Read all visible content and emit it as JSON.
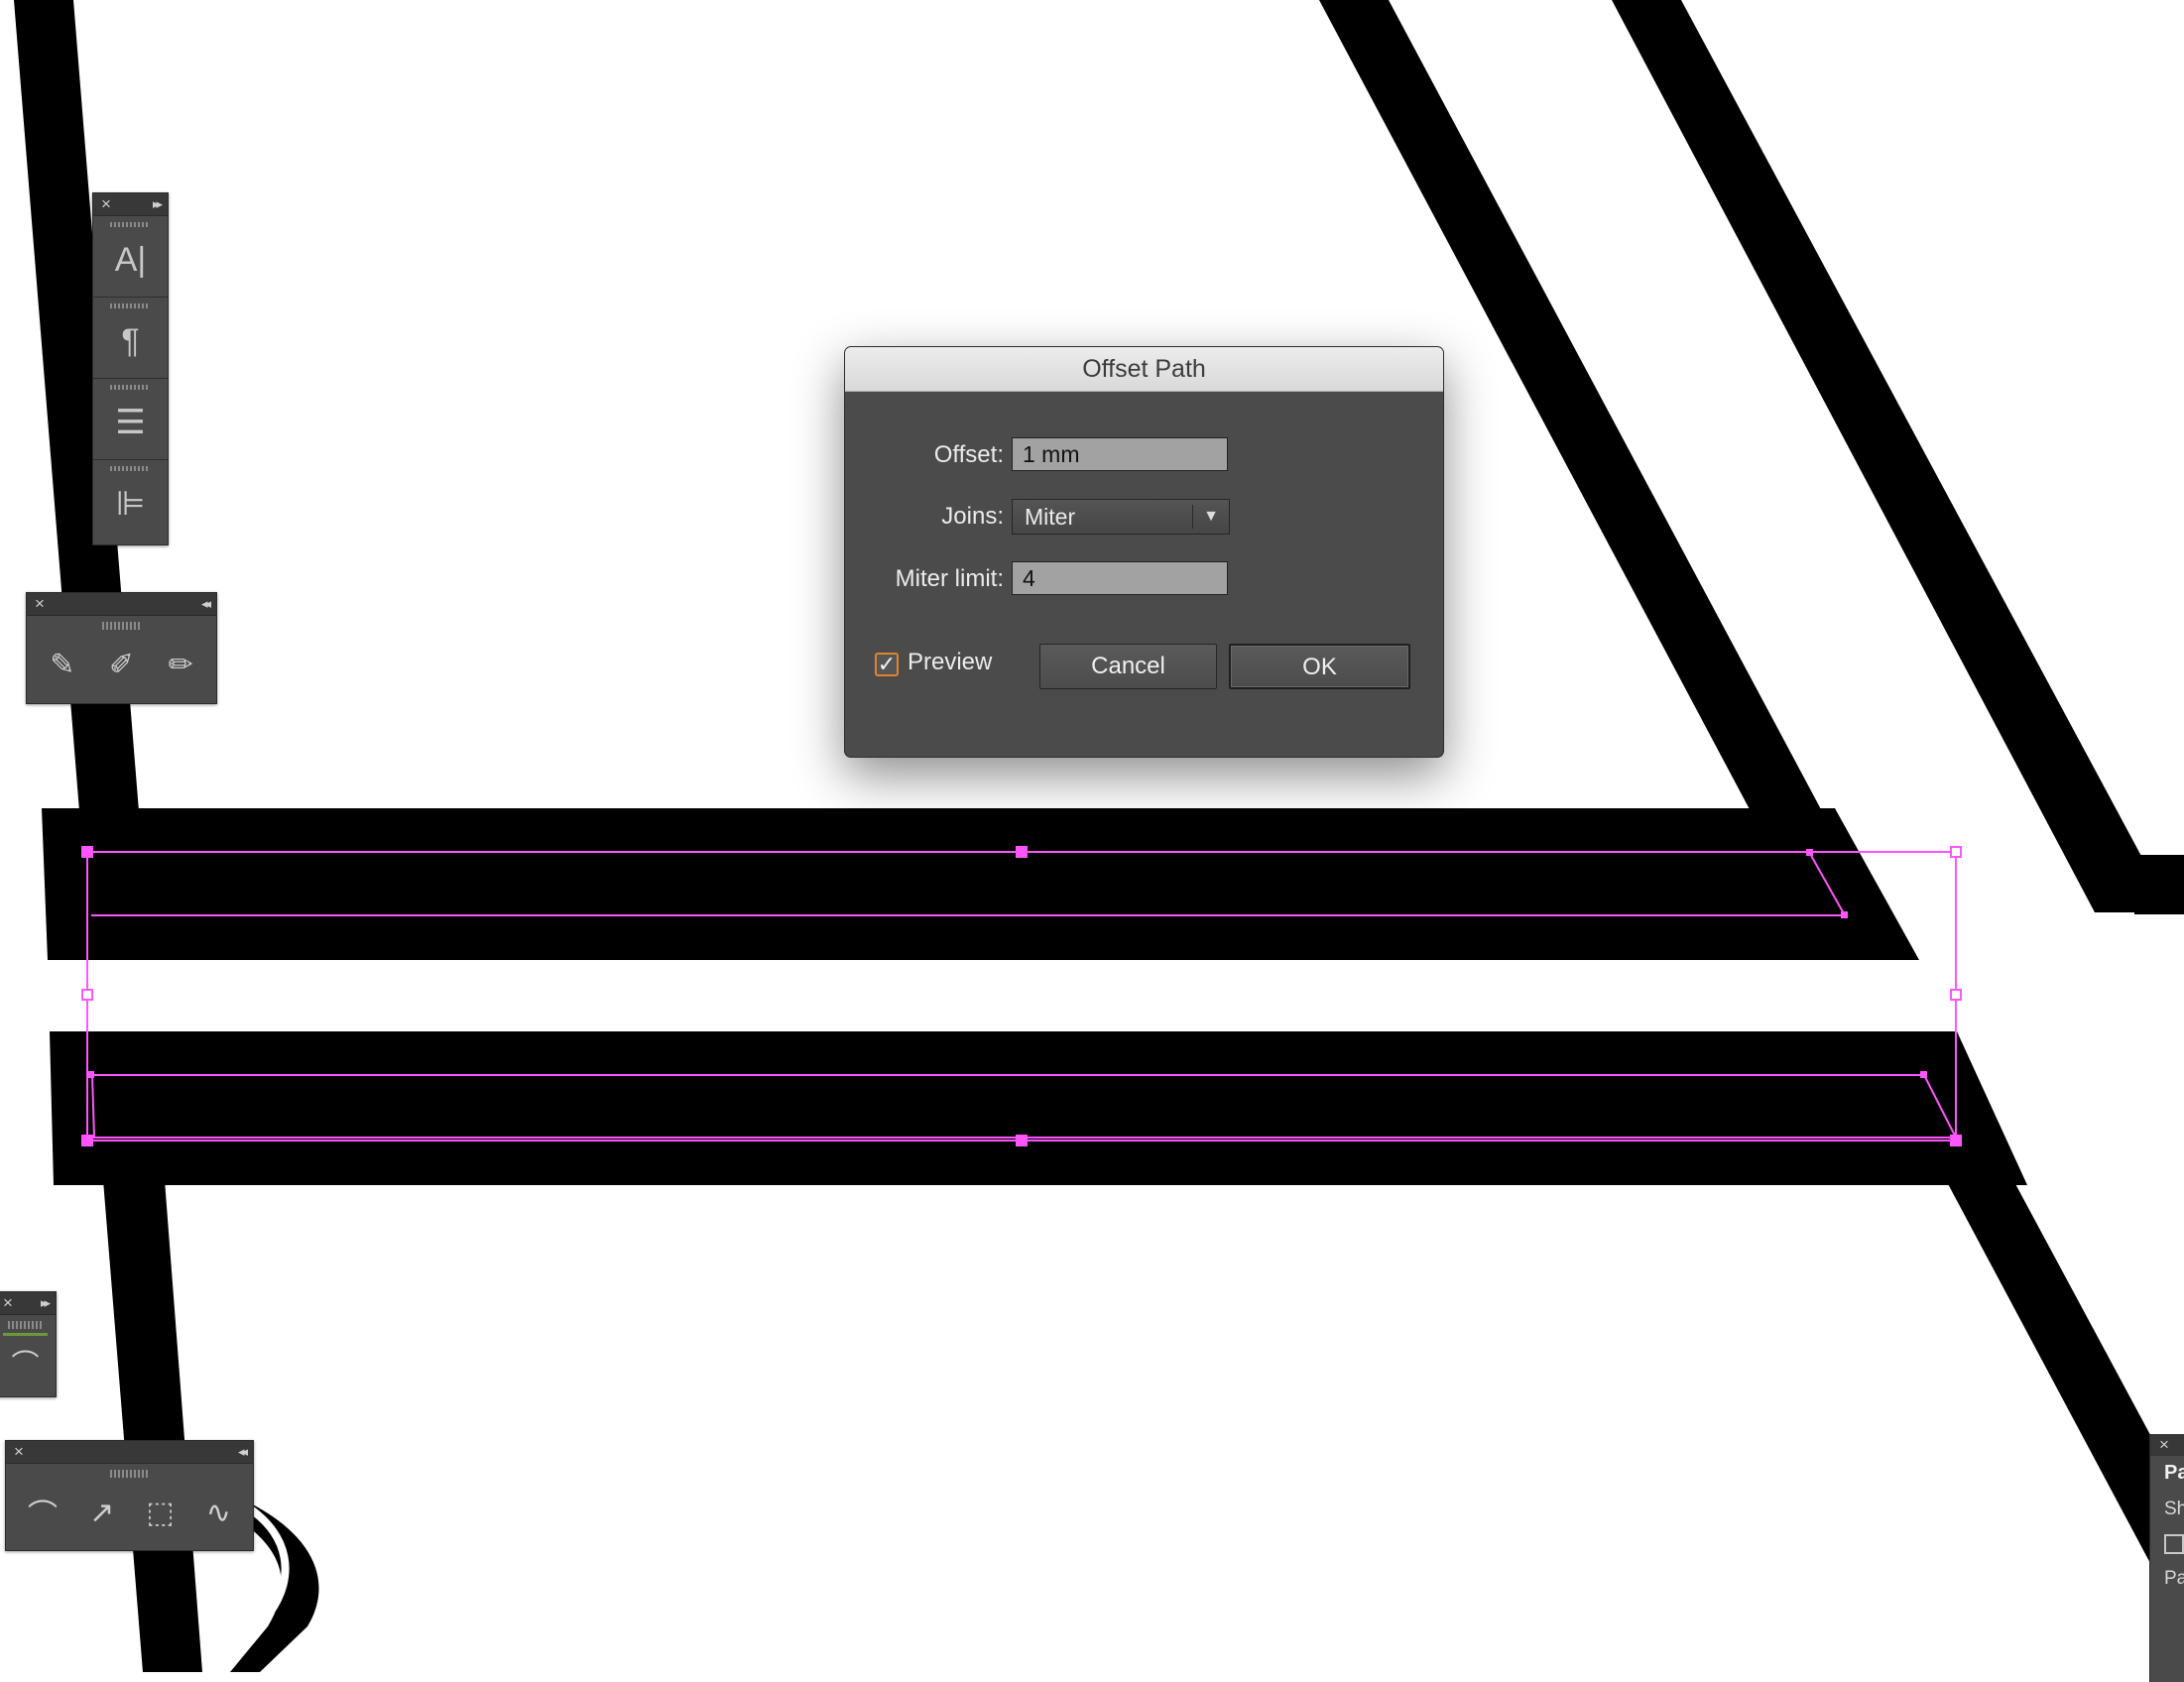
{
  "dialog": {
    "title": "Offset Path",
    "offset_label": "Offset:",
    "offset_value": "1 mm",
    "joins_label": "Joins:",
    "joins_value": "Miter",
    "miter_limit_label": "Miter limit:",
    "miter_limit_value": "4",
    "preview_label": "Preview",
    "preview_checked": true,
    "cancel_label": "Cancel",
    "ok_label": "OK"
  },
  "panels": {
    "type_panel": {
      "close": "×",
      "expand": "▸▸",
      "icons": [
        "character-icon",
        "paragraph-icon",
        "align-lines-icon",
        "align-objects-icon"
      ]
    },
    "brush_panel": {
      "close": "×",
      "collapse": "◂◂",
      "icons": [
        "pencil-icon",
        "smooth-tool-icon",
        "eraser-icon"
      ]
    },
    "small_panel": {
      "close": "×",
      "expand": "▸▸",
      "icons": [
        "anchor-point-icon"
      ]
    },
    "path_panel": {
      "close": "×",
      "collapse": "◂◂",
      "icons": [
        "anchor-point-icon",
        "curvature-icon",
        "transform-icon",
        "smooth-path-icon"
      ]
    },
    "right_panel": {
      "close": "×",
      "title": "Pa",
      "row1": "Sh",
      "row2": "Pa"
    }
  },
  "colors": {
    "selection": "#ff55ff",
    "panel_bg": "#4a4a4a",
    "dialog_bg": "#4b4b4b",
    "checkbox_accent": "#e0852a"
  }
}
